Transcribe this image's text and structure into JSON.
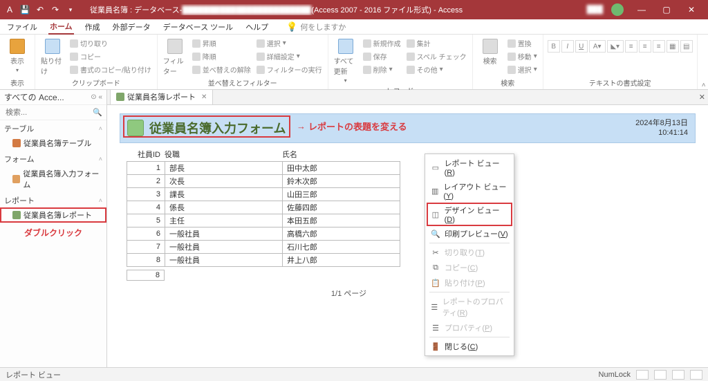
{
  "titlebar": {
    "doc_prefix": "従業員名簿 : データベース-",
    "doc_suffix": "(Access 2007 - 2016 ファイル形式)  -  Access"
  },
  "menu": {
    "file": "ファイル",
    "home": "ホーム",
    "create": "作成",
    "external": "外部データ",
    "dbtools": "データベース ツール",
    "help": "ヘルプ",
    "tellme": "何をしますか"
  },
  "ribbon": {
    "view": "表示",
    "view_grp": "表示",
    "paste": "貼り付け",
    "cut": "切り取り",
    "copy": "コピー",
    "fmtpaint": "書式のコピー/貼り付け",
    "clipboard_grp": "クリップボード",
    "filter": "フィルター",
    "asc": "昇順",
    "desc": "降順",
    "clearsort": "並べ替えの解除",
    "selection": "選択",
    "advanced": "詳細設定",
    "togglefilt": "フィルターの実行",
    "sort_grp": "並べ替えとフィルター",
    "refresh": "すべて更新",
    "new": "新規作成",
    "save": "保存",
    "delete": "削除",
    "totals": "集計",
    "spell": "スペル チェック",
    "more": "その他",
    "records_grp": "レコード",
    "find": "検索",
    "replace": "置換",
    "goto": "移動",
    "select": "選択",
    "find_grp": "検索",
    "textfmt_grp": "テキストの書式設定"
  },
  "nav": {
    "title": "すべての Acce...",
    "search_ph": "検索...",
    "grp_table": "テーブル",
    "item_table": "従業員名簿テーブル",
    "grp_form": "フォーム",
    "item_form": "従業員名簿入力フォーム",
    "grp_report": "レポート",
    "item_report": "従業員名簿レポート",
    "annotation": "ダブルクリック"
  },
  "doctab": {
    "label": "従業員名簿レポート"
  },
  "report": {
    "title": "従業員名簿入力フォーム",
    "annotation": "レポートの表題を変える",
    "date": "2024年8月13日",
    "time": "10:41:14",
    "col_id": "社員ID",
    "col_role": "役職",
    "col_name": "氏名",
    "rows": [
      {
        "id": "1",
        "role": "部長",
        "name": "田中太郎"
      },
      {
        "id": "2",
        "role": "次長",
        "name": "鈴木次郎"
      },
      {
        "id": "3",
        "role": "課長",
        "name": "山田三郎"
      },
      {
        "id": "4",
        "role": "係長",
        "name": "佐藤四郎"
      },
      {
        "id": "5",
        "role": "主任",
        "name": "本田五郎"
      },
      {
        "id": "6",
        "role": "一般社員",
        "name": "高橋六郎"
      },
      {
        "id": "7",
        "role": "一般社員",
        "name": "石川七郎"
      },
      {
        "id": "8",
        "role": "一般社員",
        "name": "井上八郎"
      }
    ],
    "total": "8",
    "pager": "1/1 ページ"
  },
  "ctx": {
    "report_view": "レポート ビュー",
    "report_view_k": "R",
    "layout_view": "レイアウト ビュー",
    "layout_view_k": "Y",
    "design_view": "デザイン ビュー",
    "design_view_k": "D",
    "print_preview": "印刷プレビュー",
    "print_preview_k": "V",
    "cut": "切り取り",
    "cut_k": "T",
    "copy": "コピー",
    "copy_k": "C",
    "paste": "貼り付け",
    "paste_k": "P",
    "rep_props": "レポートのプロパティ",
    "rep_props_k": "R",
    "props": "プロパティ",
    "props_k": "P",
    "close": "閉じる",
    "close_k": "C"
  },
  "status": {
    "left": "レポート ビュー",
    "numlock": "NumLock"
  }
}
